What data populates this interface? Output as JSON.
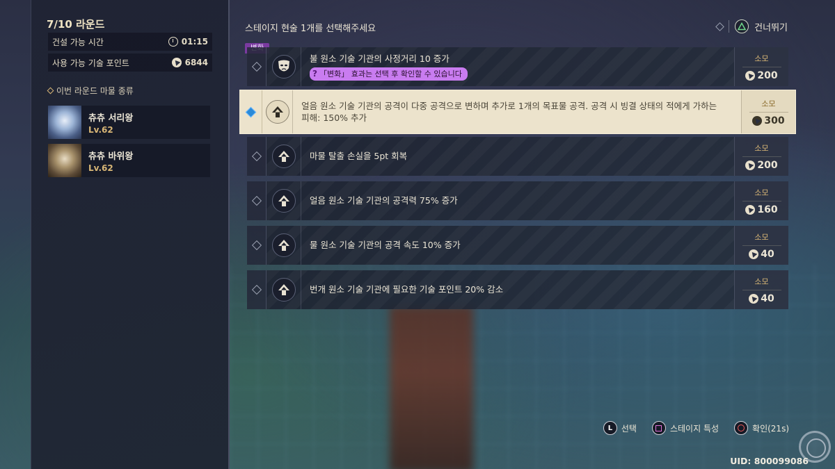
{
  "round": {
    "title": "7/10 라운드"
  },
  "build_time": {
    "label": "건설 가능 시간",
    "value": "01:15"
  },
  "tech_points": {
    "label": "사용 가능 기술 포인트",
    "value": "6844"
  },
  "monsters_section": {
    "label": "이번 라운드 마물 종류"
  },
  "monsters": [
    {
      "name": "츄츄 서리왕",
      "level": "Lv.62",
      "icon": "ice-monster-portrait"
    },
    {
      "name": "츄츄 바위왕",
      "level": "Lv.62",
      "icon": "rock-monster-portrait"
    }
  ],
  "header": {
    "instruction": "스테이지 현술 1개를 선택해주세요",
    "skip_label": "건너뛰기"
  },
  "change_tag": "변화",
  "options": [
    {
      "text": "불 원소 기술 기관의 사정거리 10 증가",
      "note": "「변화」 효과는 선택 후 확인할 수 있습니다",
      "cost_label": "소모",
      "cost": "200",
      "icon": "mask-icon",
      "selected": false
    },
    {
      "text": "얼음 원소 기술 기관의 공격이 다중 공격으로 변하며 추가로 1개의 목표물 공격. 공격 시 빙결 상태의 적에게 가하는 피해: 150% 추가",
      "cost_label": "소모",
      "cost": "300",
      "icon": "upgrade-arrow-icon",
      "selected": true
    },
    {
      "text": "마물 탈출 손실을 5pt 회복",
      "cost_label": "소모",
      "cost": "200",
      "icon": "upgrade-arrow-icon",
      "selected": false
    },
    {
      "text": "얼음 원소 기술 기관의 공격력 75% 증가",
      "cost_label": "소모",
      "cost": "160",
      "icon": "upgrade-arrow-icon",
      "selected": false
    },
    {
      "text": "물 원소 기술 기관의 공격 속도 10% 증가",
      "cost_label": "소모",
      "cost": "40",
      "icon": "upgrade-arrow-icon",
      "selected": false
    },
    {
      "text": "번개 원소 기술 기관에 필요한 기술 포인트 20% 감소",
      "cost_label": "소모",
      "cost": "40",
      "icon": "upgrade-arrow-icon",
      "selected": false
    }
  ],
  "hints": {
    "select": {
      "button": "L",
      "label": "선택"
    },
    "stage_traits": {
      "label": "스테이지 특성"
    },
    "confirm": {
      "label": "확인(21s)"
    }
  },
  "uid": "UID: 800099086",
  "colors": {
    "accent_gold": "#d8b676",
    "selected_bg": "#ece3cc",
    "change_purple": "#7a3aa0",
    "pill_purple": "#c97cf0"
  }
}
